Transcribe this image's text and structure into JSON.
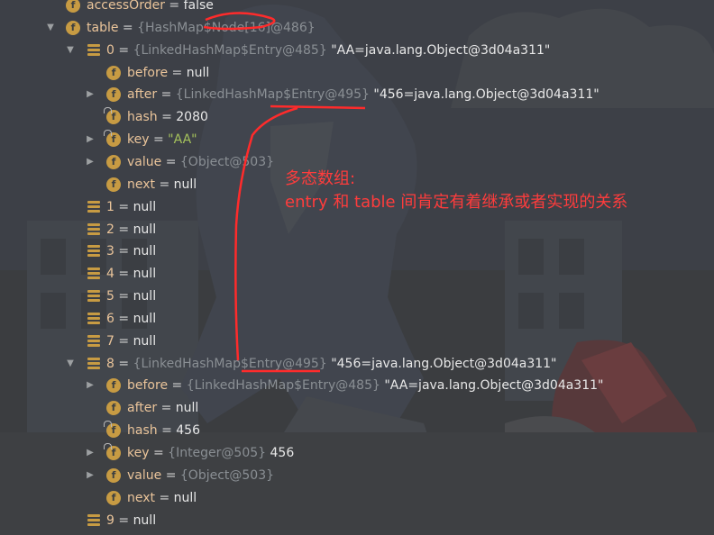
{
  "rows": [
    {
      "indent": 0,
      "expander": "none",
      "icon": "field",
      "name": "accessOrder",
      "eq": "=",
      "value": "false",
      "ref": "",
      "detail": ""
    },
    {
      "indent": 0,
      "expander": "expanded",
      "icon": "field",
      "name": "table",
      "eq": "=",
      "value": "",
      "ref": "{HashMap$Node[16]@486}",
      "detail": ""
    },
    {
      "indent": 1,
      "expander": "expanded",
      "icon": "array",
      "name": "0",
      "eq": "=",
      "value": "",
      "ref": "{LinkedHashMap$Entry@485}",
      "detail": "\"AA=java.lang.Object@3d04a311\""
    },
    {
      "indent": 2,
      "expander": "none",
      "icon": "field",
      "name": "before",
      "eq": "=",
      "value": "null",
      "ref": "",
      "detail": ""
    },
    {
      "indent": 2,
      "expander": "collapsed",
      "icon": "field",
      "name": "after",
      "eq": "=",
      "value": "",
      "ref": "{LinkedHashMap$Entry@495}",
      "detail": "\"456=java.lang.Object@3d04a311\""
    },
    {
      "indent": 2,
      "expander": "none",
      "icon": "field-final",
      "name": "hash",
      "eq": "=",
      "value": "2080",
      "ref": "",
      "detail": ""
    },
    {
      "indent": 2,
      "expander": "collapsed",
      "icon": "field-final",
      "name": "key",
      "eq": "=",
      "value": "",
      "ref": "",
      "detail": "",
      "string": "\"AA\""
    },
    {
      "indent": 2,
      "expander": "collapsed",
      "icon": "field",
      "name": "value",
      "eq": "=",
      "value": "",
      "ref": "{Object@503}",
      "detail": ""
    },
    {
      "indent": 2,
      "expander": "none",
      "icon": "field",
      "name": "next",
      "eq": "=",
      "value": "null",
      "ref": "",
      "detail": ""
    },
    {
      "indent": 1,
      "expander": "none",
      "icon": "array",
      "name": "1",
      "eq": "=",
      "value": "null",
      "ref": "",
      "detail": ""
    },
    {
      "indent": 1,
      "expander": "none",
      "icon": "array",
      "name": "2",
      "eq": "=",
      "value": "null",
      "ref": "",
      "detail": ""
    },
    {
      "indent": 1,
      "expander": "none",
      "icon": "array",
      "name": "3",
      "eq": "=",
      "value": "null",
      "ref": "",
      "detail": ""
    },
    {
      "indent": 1,
      "expander": "none",
      "icon": "array",
      "name": "4",
      "eq": "=",
      "value": "null",
      "ref": "",
      "detail": ""
    },
    {
      "indent": 1,
      "expander": "none",
      "icon": "array",
      "name": "5",
      "eq": "=",
      "value": "null",
      "ref": "",
      "detail": ""
    },
    {
      "indent": 1,
      "expander": "none",
      "icon": "array",
      "name": "6",
      "eq": "=",
      "value": "null",
      "ref": "",
      "detail": ""
    },
    {
      "indent": 1,
      "expander": "none",
      "icon": "array",
      "name": "7",
      "eq": "=",
      "value": "null",
      "ref": "",
      "detail": ""
    },
    {
      "indent": 1,
      "expander": "expanded",
      "icon": "array",
      "name": "8",
      "eq": "=",
      "value": "",
      "ref": "{LinkedHashMap$Entry@495}",
      "detail": "\"456=java.lang.Object@3d04a311\""
    },
    {
      "indent": 2,
      "expander": "collapsed",
      "icon": "field",
      "name": "before",
      "eq": "=",
      "value": "",
      "ref": "{LinkedHashMap$Entry@485}",
      "detail": "\"AA=java.lang.Object@3d04a311\""
    },
    {
      "indent": 2,
      "expander": "none",
      "icon": "field",
      "name": "after",
      "eq": "=",
      "value": "null",
      "ref": "",
      "detail": ""
    },
    {
      "indent": 2,
      "expander": "none",
      "icon": "field-final",
      "name": "hash",
      "eq": "=",
      "value": "456",
      "ref": "",
      "detail": ""
    },
    {
      "indent": 2,
      "expander": "collapsed",
      "icon": "field-final",
      "name": "key",
      "eq": "=",
      "value": "",
      "ref": "{Integer@505}",
      "detail": "456"
    },
    {
      "indent": 2,
      "expander": "collapsed",
      "icon": "field",
      "name": "value",
      "eq": "=",
      "value": "",
      "ref": "{Object@503}",
      "detail": ""
    },
    {
      "indent": 2,
      "expander": "none",
      "icon": "field",
      "name": "next",
      "eq": "=",
      "value": "null",
      "ref": "",
      "detail": ""
    },
    {
      "indent": 1,
      "expander": "none",
      "icon": "array",
      "name": "9",
      "eq": "=",
      "value": "null",
      "ref": "",
      "detail": ""
    }
  ],
  "icons": {
    "field_glyph": "f",
    "expanded_glyph": "▼",
    "collapsed_glyph": "▶"
  },
  "annotation": {
    "line1": "多态数组:",
    "line2": "entry 和 table 间肯定有着继承或者实现的关系"
  },
  "colors": {
    "annotation": "#ff3c3c",
    "field_icon": "#c79b43",
    "name": "#eac49a",
    "string": "#a5c25c",
    "ref": "#8a8f94"
  }
}
